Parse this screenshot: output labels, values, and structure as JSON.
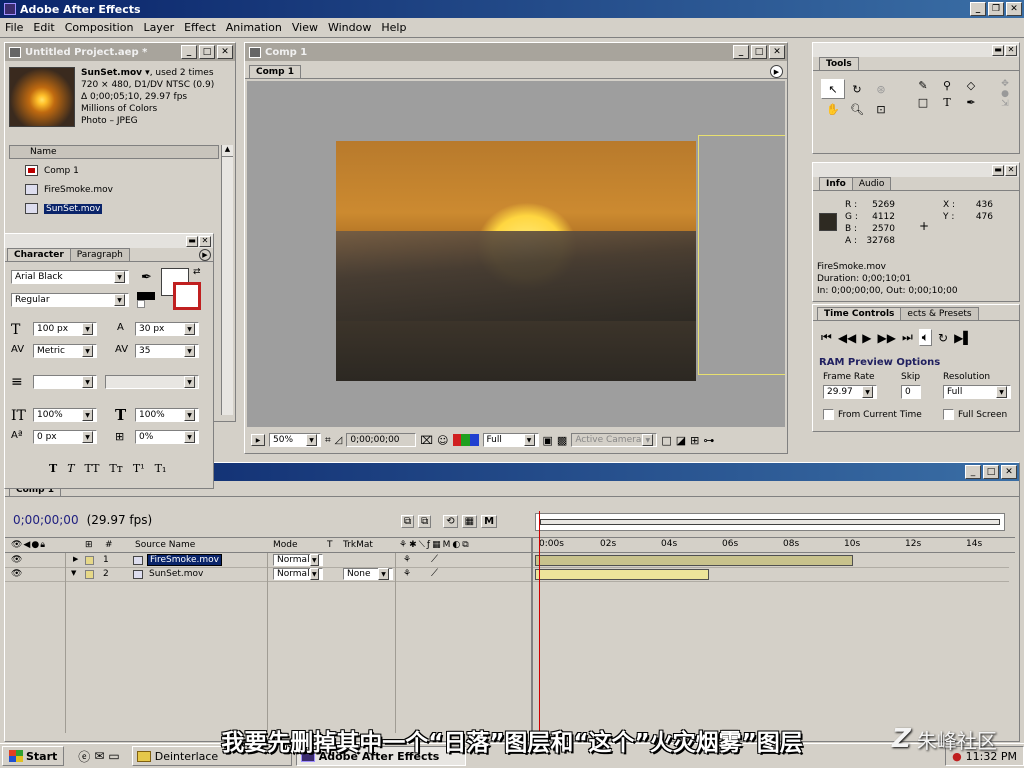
{
  "app": {
    "title": "Adobe After Effects"
  },
  "menu": [
    "File",
    "Edit",
    "Composition",
    "Layer",
    "Effect",
    "Animation",
    "View",
    "Window",
    "Help"
  ],
  "project": {
    "title": "Untitled Project.aep *",
    "file": {
      "name": "SunSet.mov ▾",
      "used": ", used 2 times",
      "dims": "720 × 480, D1/DV NTSC (0.9)",
      "duration": "Δ 0;00;05;10, 29.97 fps",
      "colors": "Millions of Colors",
      "codec": "Photo – JPEG"
    },
    "col_name": "Name",
    "items": [
      "Comp 1",
      "FireSmoke.mov",
      "SunSet.mov"
    ]
  },
  "character": {
    "tabs": [
      "Character",
      "Paragraph"
    ],
    "font": "Arial Black",
    "style": "Regular",
    "size": "100 px",
    "leading": "30 px",
    "kerning": "Metric",
    "tracking": "35",
    "vscale": "100%",
    "hscale": "100%",
    "baseline": "0 px",
    "tsume": "0%",
    "styles": [
      "T",
      "T",
      "TT",
      "Tт",
      "T¹",
      "T₁"
    ]
  },
  "comp": {
    "title": "Comp 1",
    "tab": "Comp 1",
    "zoom": "50%",
    "timecode": "0;00;00;00",
    "resolution": "Full",
    "camera": "Active Camera"
  },
  "tools": {
    "title": "Tools"
  },
  "info": {
    "tabs": [
      "Info",
      "Audio"
    ],
    "r": "R :",
    "r_val": "5269",
    "g": "G :",
    "g_val": "4112",
    "b": "B :",
    "b_val": "2570",
    "a": "A :",
    "a_val": "32768",
    "x": "X :",
    "x_val": "436",
    "y": "Y :",
    "y_val": "476",
    "file": "FireSmoke.mov",
    "duration": "Duration: 0;00;10;01",
    "inout": "In: 0;00;00;00, Out: 0;00;10;00"
  },
  "time_controls": {
    "tabs": [
      "Time Controls",
      "ects & Presets"
    ],
    "ram_title": "RAM Preview Options",
    "frame_rate_label": "Frame Rate",
    "frame_rate": "29.97",
    "skip_label": "Skip",
    "skip": "0",
    "res_label": "Resolution",
    "res": "Full",
    "from_current": "From Current Time",
    "full_screen": "Full Screen"
  },
  "timeline": {
    "tab": "Comp 1",
    "timecode": "0;00;00;00",
    "fps": "(29.97 fps)",
    "headers": {
      "num": "#",
      "source": "Source Name",
      "mode": "Mode",
      "t": "T",
      "trkmat": "TrkMat"
    },
    "ruler": [
      "0:00s",
      "02s",
      "04s",
      "06s",
      "08s",
      "10s",
      "12s",
      "14s"
    ],
    "layers": [
      {
        "num": "1",
        "name": "FireSmoke.mov",
        "mode": "Normal",
        "trkmat": ""
      },
      {
        "num": "2",
        "name": "SunSet.mov",
        "mode": "Normal",
        "trkmat": "None"
      }
    ]
  },
  "subtitle": "我要先删掉其中一个“日落”图层和“这个”火灾烟雾”图层",
  "watermark": "朱峰社区",
  "taskbar": {
    "start": "Start",
    "items": [
      "Deinterlace",
      "Adobe After Effects"
    ],
    "clock": "11:32 PM"
  }
}
